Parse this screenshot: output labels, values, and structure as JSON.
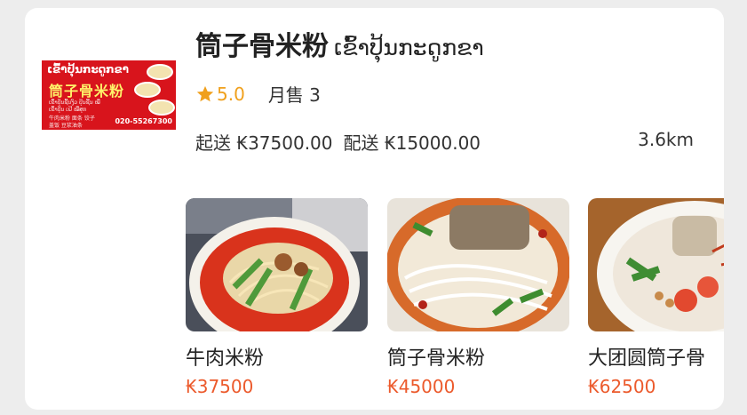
{
  "shop": {
    "name": "筒子骨米粉",
    "name_lao": "ເຂົ້າປຸ້ນກະດູກຂາ",
    "rating": "5.0",
    "monthly_sales": "月售 3",
    "min_order": "起送 ₭37500.00",
    "delivery_fee": "配送 ₭15000.00",
    "distance": "3.6km",
    "logo": {
      "lao": "ເຂົ້າປຸ້ນກະດູກຂາ",
      "cn": "筒子骨米粉",
      "line1": "ເຂົ້າປຸ້ນຊີ້ນງົວ  ປຸ້ນຊີ້ນ  ໝີ່",
      "line2": "ເຂົ້າປຸ້ນ  ເຝີ  ໝີ່ສຸກ",
      "line3": "牛肉米粉  面条  饺子",
      "line4": "盖饭  豆浆油条",
      "phone": "020-55267300"
    }
  },
  "dishes": [
    {
      "name": "牛肉米粉",
      "price": "₭37500"
    },
    {
      "name": "筒子骨米粉",
      "price": "₭45000"
    },
    {
      "name": "大团圆筒子骨",
      "price": "₭62500"
    }
  ],
  "colors": {
    "accent_orange": "#f0a01c",
    "price_red": "#ec5a2c",
    "logo_red": "#d8141c"
  }
}
